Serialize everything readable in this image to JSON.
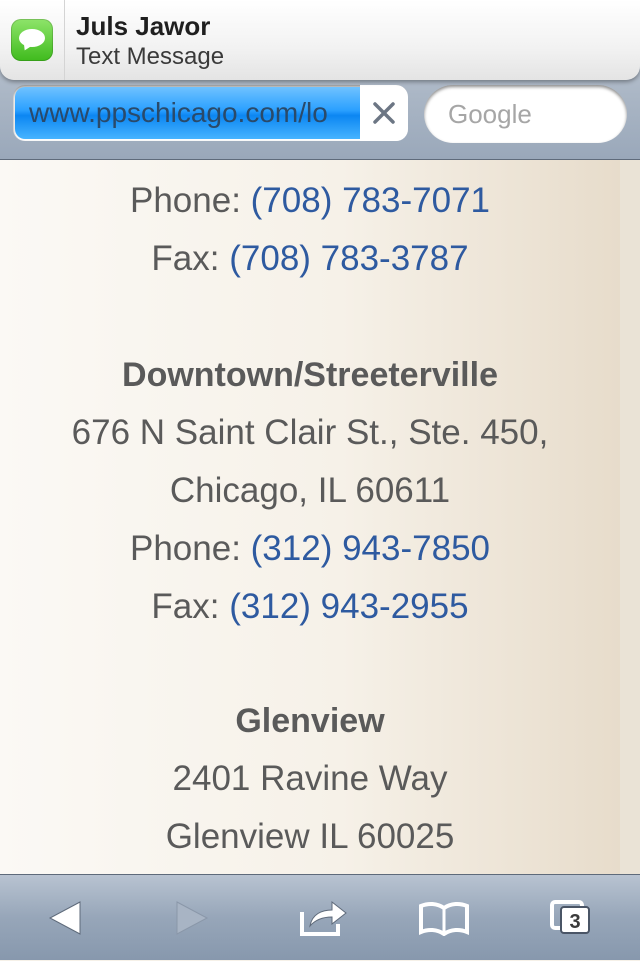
{
  "notification": {
    "sender": "Juls Jawor",
    "type": "Text Message",
    "icon": "messages-icon"
  },
  "browser": {
    "url": "www.ppschicago.com/lo",
    "search_placeholder": "Google",
    "accent_color": "#2aa0ff"
  },
  "page": {
    "locations": [
      {
        "name": "",
        "address_lines": [],
        "phone_label": "Phone:",
        "phone": "(708) 783-7071",
        "fax_label": "Fax:",
        "fax": "(708) 783-3787"
      },
      {
        "name": "Downtown/Streeterville",
        "address_lines": [
          "676 N Saint Clair St., Ste. 450,",
          "Chicago, IL 60611"
        ],
        "phone_label": "Phone:",
        "phone": "(312) 943-7850",
        "fax_label": "Fax:",
        "fax": "(312) 943-2955"
      },
      {
        "name": "Glenview",
        "address_lines": [
          "2401 Ravine Way",
          "Glenview IL 60025"
        ]
      }
    ],
    "link_color": "#2e5aa0",
    "text_color": "#5a5a5a"
  },
  "toolbar": {
    "buttons": [
      "back-icon",
      "forward-icon",
      "share-icon",
      "bookmarks-icon",
      "tabs-icon"
    ],
    "tabs_count": "3"
  }
}
